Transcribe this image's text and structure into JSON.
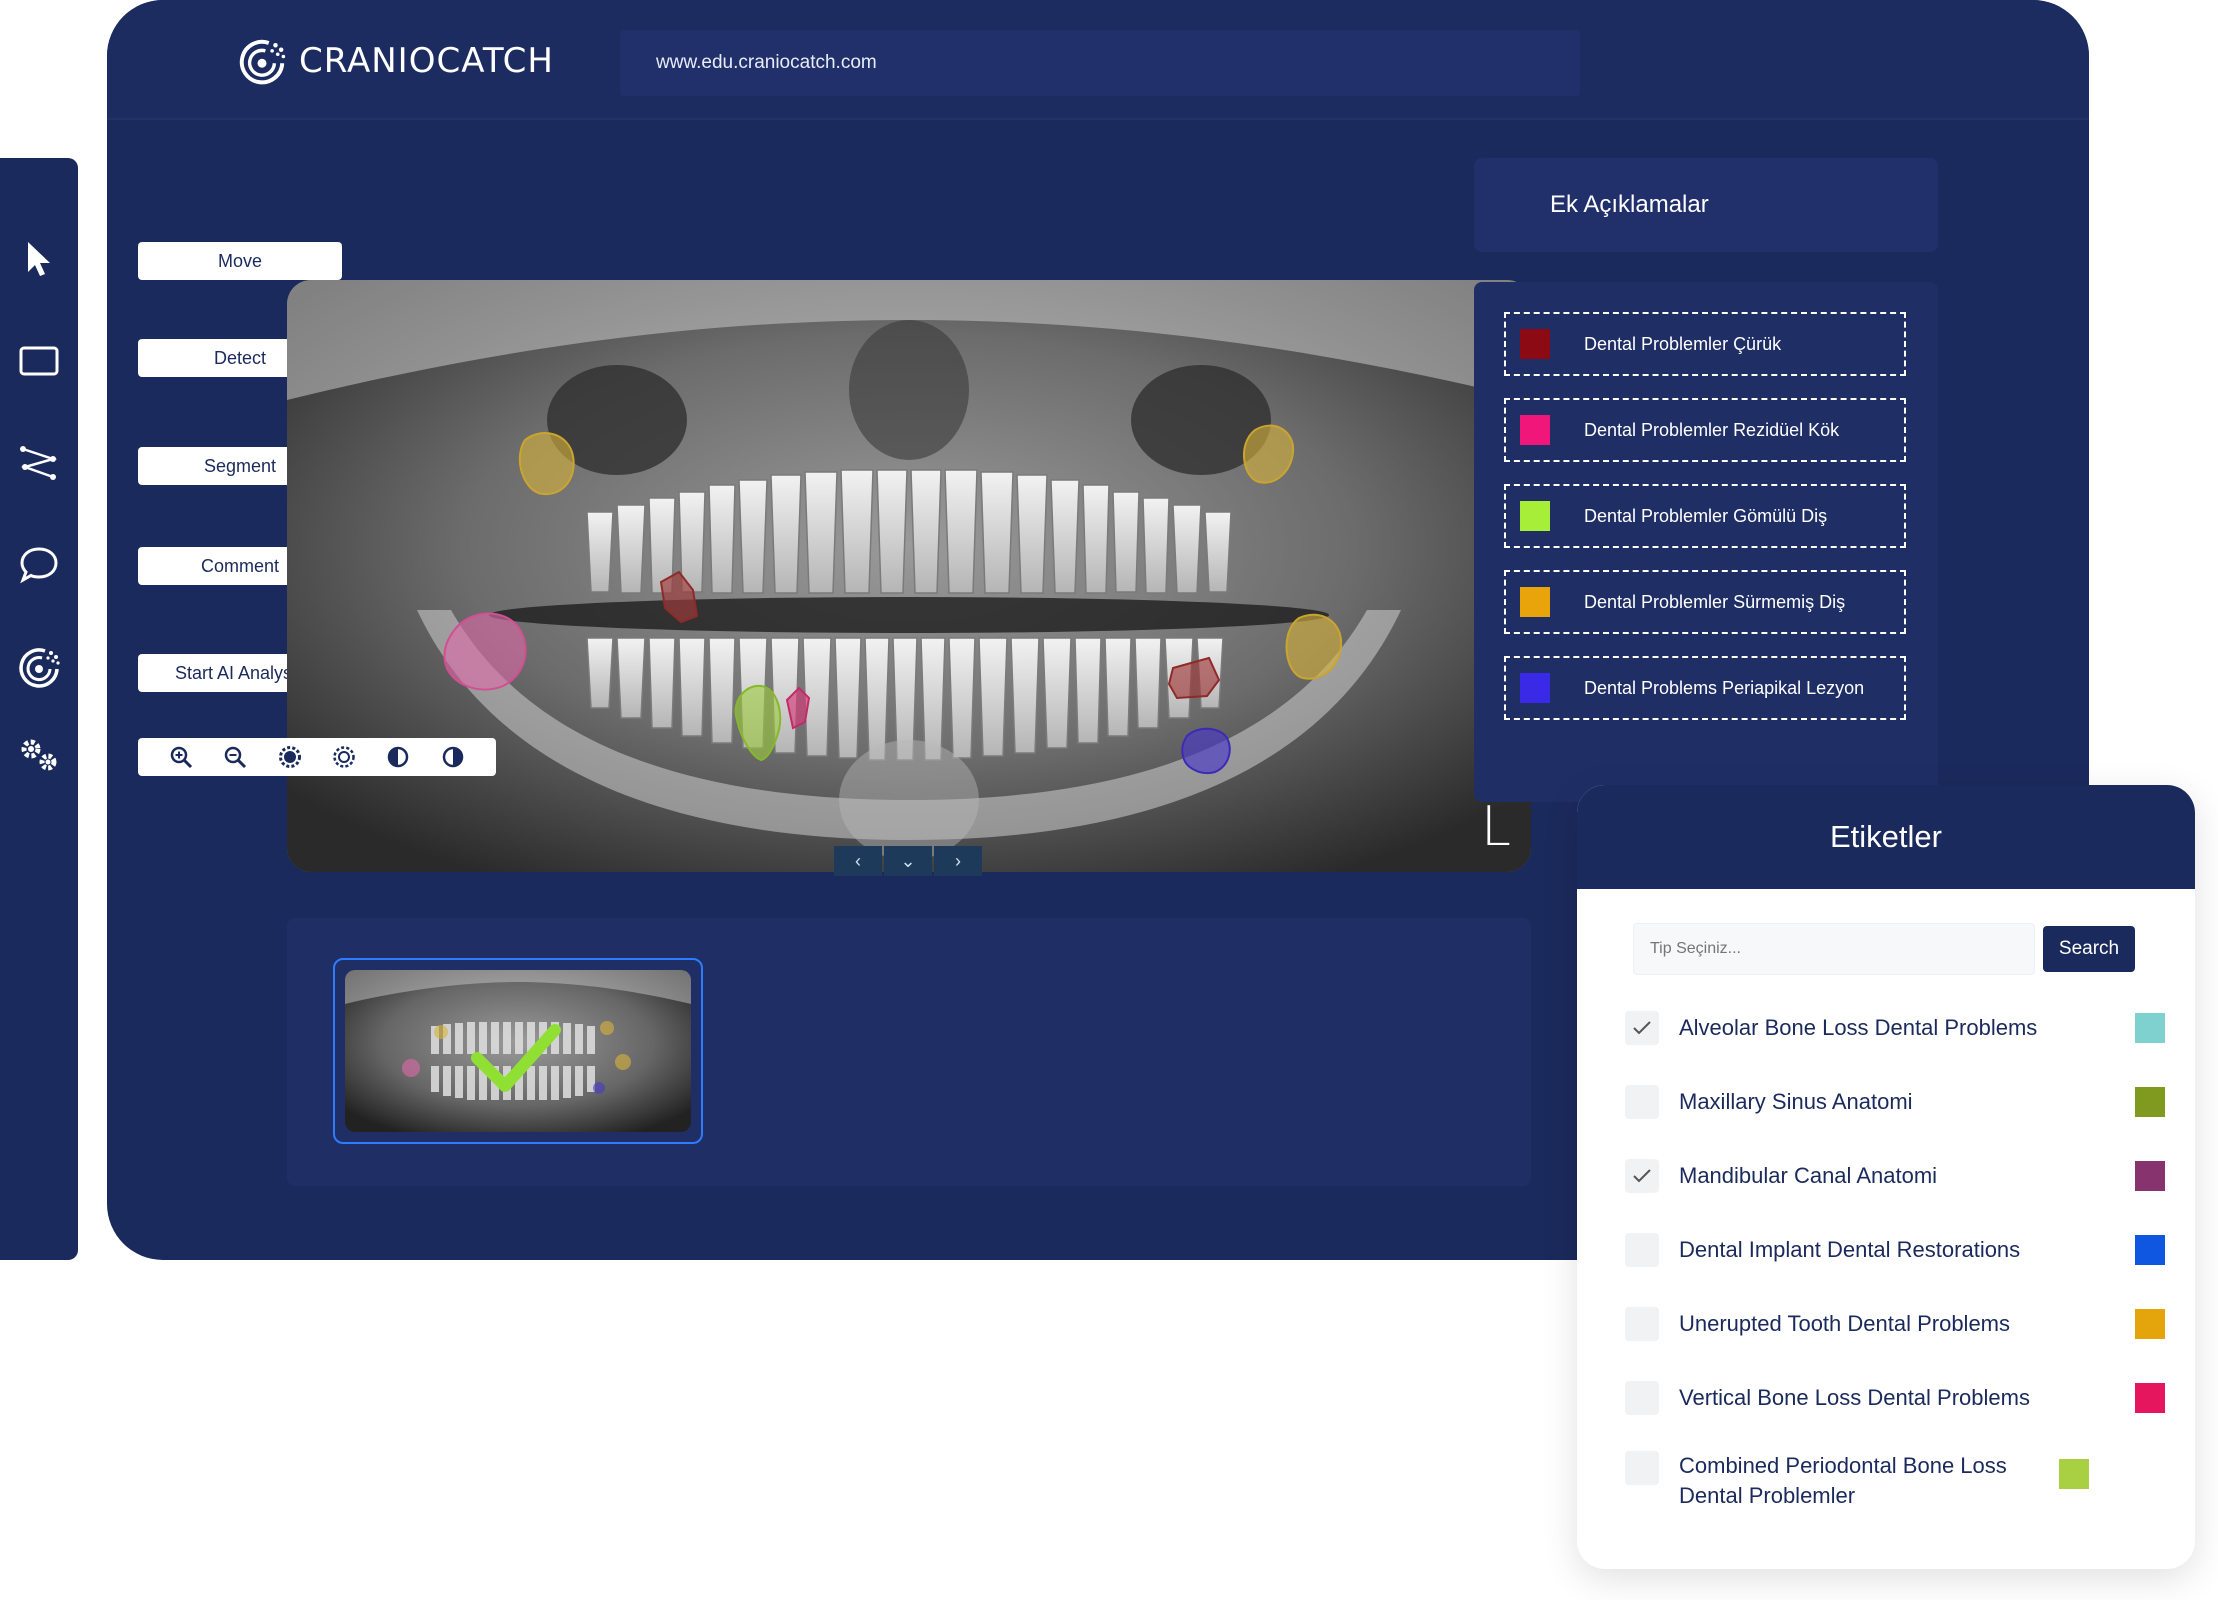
{
  "browser": {
    "brand": "CRANIOCATCH",
    "url": "www.edu.craniocatch.com"
  },
  "toolbar": {
    "tools": [
      {
        "icon": "pointer-icon"
      },
      {
        "icon": "rectangle-icon"
      },
      {
        "icon": "polyline-icon"
      },
      {
        "icon": "comment-icon"
      },
      {
        "icon": "craniocatch-logo-icon"
      },
      {
        "icon": "settings-gears-icon"
      }
    ]
  },
  "modes": {
    "move": "Move",
    "detect": "Detect",
    "segment": "Segment",
    "comment": "Comment",
    "start_ai": "Start AI Analysis"
  },
  "image_tools": [
    "zoom-in-icon",
    "zoom-out-icon",
    "brightness-up-icon",
    "brightness-down-icon",
    "contrast-icon",
    "invert-icon"
  ],
  "viewer": {
    "orientation_marker": "L",
    "nav": [
      "‹",
      "⌄",
      "›"
    ]
  },
  "ek": {
    "title": "Ek Açıklamalar",
    "items": [
      {
        "label": "Dental Problemler Çürük",
        "color": "#8b0a14"
      },
      {
        "label": "Dental Problemler Rezidüel Kök",
        "color": "#f0167a"
      },
      {
        "label": "Dental Problemler Gömülü Diş",
        "color": "#a6ee37"
      },
      {
        "label": "Dental Problemler Sürmemiş Diş",
        "color": "#e8a40a"
      },
      {
        "label": "Dental Problems Periapikal Lezyon",
        "color": "#3b29e8"
      }
    ]
  },
  "etiketler": {
    "title": "Etiketler",
    "search_placeholder": "Tip Seçiniz...",
    "search_label": "Search",
    "items": [
      {
        "label": "Alveolar Bone Loss Dental Problems",
        "checked": true,
        "color": "#7fd1cf"
      },
      {
        "label": "Maxillary Sinus Anatomi",
        "checked": false,
        "color": "#7f9a1e"
      },
      {
        "label": "Mandibular Canal Anatomi",
        "checked": true,
        "color": "#86336e"
      },
      {
        "label": "Dental Implant Dental Restorations",
        "checked": false,
        "color": "#0f57e0"
      },
      {
        "label": "Unerupted Tooth Dental Problems",
        "checked": false,
        "color": "#e3a50b"
      },
      {
        "label": "Vertical Bone Loss Dental Problems",
        "checked": false,
        "color": "#e5165e"
      },
      {
        "label": "Combined Periodontal Bone Loss Dental Problemler",
        "checked": false,
        "color": "#a9cf42"
      }
    ]
  }
}
